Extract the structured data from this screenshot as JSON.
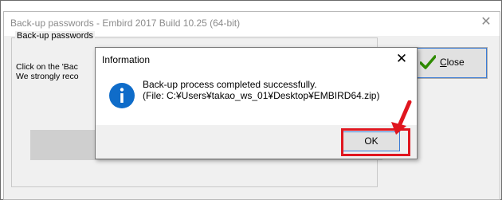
{
  "window": {
    "title": "Back-up passwords - Embird 2017 Build 10.25 (64-bit)",
    "close_symbol": "✕",
    "group": {
      "legend": "Back-up passwords",
      "line1": "Click on the 'Bac",
      "line2": "We strongly reco"
    },
    "close_button": {
      "label_underlined": "C",
      "label_rest": "lose",
      "icon": "check-icon",
      "icon_color": "#2e8b00"
    }
  },
  "dialog": {
    "title": "Information",
    "close_symbol": "✕",
    "icon": "info-icon",
    "icon_color": "#0f6cc9",
    "message_line1": "Back-up process completed successfully.",
    "message_line2": "(File: C:¥Users¥takao_ws_01¥Desktop¥EMBIRD64.zip)",
    "ok_label": "OK"
  },
  "annotation": {
    "highlight_color": "#e0161f",
    "arrow": "red-arrow-icon"
  }
}
